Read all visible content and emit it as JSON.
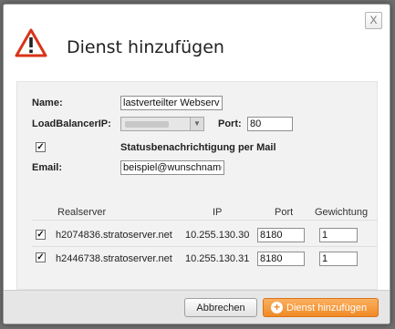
{
  "dialog": {
    "title": "Dienst hinzufügen",
    "close_label": "X"
  },
  "form": {
    "name_label": "Name:",
    "name_value": "lastverteilter Webserver",
    "lb_ip_label": "LoadBalancerIP:",
    "port_label": "Port:",
    "port_value": "80",
    "status_checked": true,
    "status_label": "Statusbenachrichtigung per Mail",
    "email_label": "Email:",
    "email_value": "beispiel@wunschname.de"
  },
  "table": {
    "headers": {
      "realserver": "Realserver",
      "ip": "IP",
      "port": "Port",
      "weight": "Gewichtung"
    },
    "rows": [
      {
        "checked": true,
        "server": "h2074836.stratoserver.net",
        "ip": "10.255.130.30",
        "port": "8180",
        "weight": "1"
      },
      {
        "checked": true,
        "server": "h2446738.stratoserver.net",
        "ip": "10.255.130.31",
        "port": "8180",
        "weight": "1"
      }
    ]
  },
  "footer": {
    "cancel_label": "Abbrechen",
    "add_label": "Dienst hinzufügen"
  },
  "colors": {
    "accent": "#f08a25",
    "warning_border": "#d9331a"
  },
  "icons": {
    "warning": "warning-triangle-icon",
    "add": "plus-circle-icon",
    "close": "close-icon"
  }
}
